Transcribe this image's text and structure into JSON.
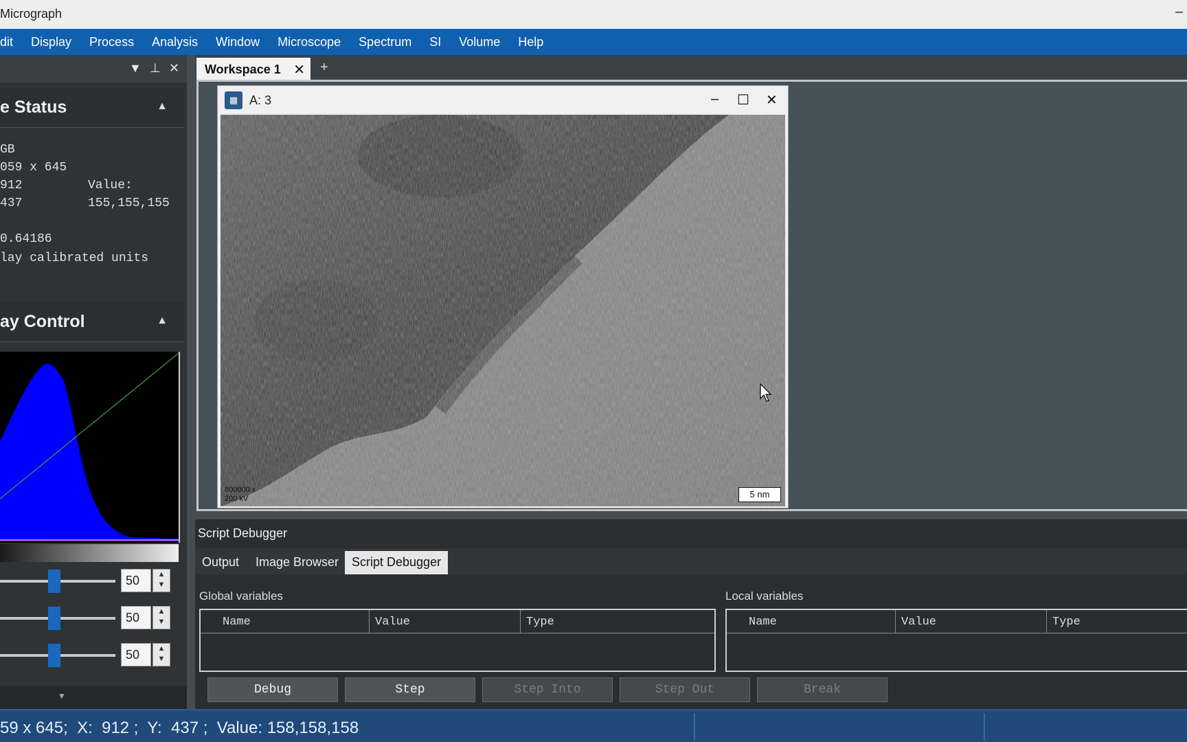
{
  "window": {
    "title": "Micrograph",
    "minimize_glyph": "–"
  },
  "menu": [
    "dit",
    "Display",
    "Process",
    "Analysis",
    "Window",
    "Microscope",
    "Spectrum",
    "SI",
    "Volume",
    "Help"
  ],
  "left_panel": {
    "image_status": {
      "heading": "e Status",
      "lines": [
        "GB",
        "059 x 645",
        "912",
        "437",
        "",
        "0.64186",
        "lay calibrated units"
      ],
      "value_label": "Value:",
      "value": "155,155,155"
    },
    "display_control": {
      "heading": "ay Control",
      "sliders": [
        {
          "value": "50"
        },
        {
          "value": "50"
        },
        {
          "value": "50"
        }
      ]
    }
  },
  "workspace": {
    "tab_label": "Workspace 1",
    "add_tab": "+",
    "image_window": {
      "title": "A: 3",
      "magnification": "800000 x",
      "voltage": "200 kV",
      "scale_bar": "5 nm"
    }
  },
  "debugger": {
    "title": "Script Debugger",
    "tabs": [
      "Output",
      "Image Browser",
      "Script Debugger"
    ],
    "active_tab": "Script Debugger",
    "global_label": "Global variables",
    "local_label": "Local variables",
    "columns": [
      "Name",
      "Value",
      "Type"
    ],
    "buttons": [
      {
        "label": "Debug",
        "enabled": true
      },
      {
        "label": "Step",
        "enabled": true
      },
      {
        "label": "Step Into",
        "enabled": false
      },
      {
        "label": "Step Out",
        "enabled": false
      },
      {
        "label": "Break",
        "enabled": false
      }
    ]
  },
  "status_bar": {
    "text": "59 x 645;  X:  912 ;  Y:  437 ;  Value: 158,158,158"
  },
  "colors": {
    "accent": "#1060b0",
    "histogram": "#0000ff",
    "status_bar": "#1f4a7a"
  }
}
